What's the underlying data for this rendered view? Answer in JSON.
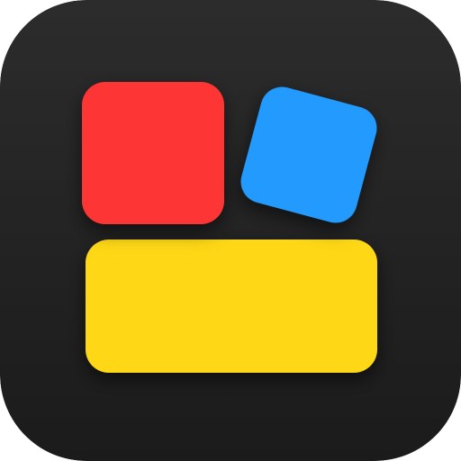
{
  "icon": {
    "name": "widget-tiles-app-icon",
    "colors": {
      "background_top": "#2c2c2c",
      "background_bottom": "#1b1b1b",
      "tile_red": "#fe3636",
      "tile_blue": "#229afe",
      "tile_yellow": "#fed714",
      "shadow": "#000000"
    },
    "tiles": [
      {
        "id": "red",
        "name": "red-square-tile",
        "color_key": "tile_red"
      },
      {
        "id": "blue",
        "name": "blue-square-tile-tilted",
        "color_key": "tile_blue"
      },
      {
        "id": "yellow",
        "name": "yellow-wide-tile",
        "color_key": "tile_yellow"
      }
    ]
  }
}
